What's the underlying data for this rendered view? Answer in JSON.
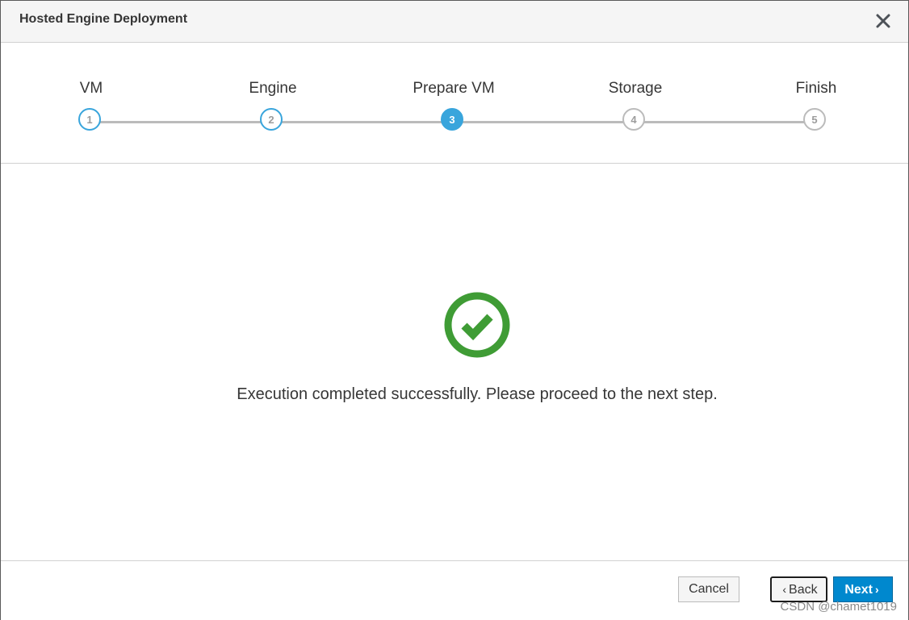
{
  "dialog": {
    "title": "Hosted Engine Deployment",
    "close_icon": "close-x-icon"
  },
  "wizard": {
    "steps": [
      {
        "label": "VM",
        "number": "1",
        "state": "done"
      },
      {
        "label": "Engine",
        "number": "2",
        "state": "done"
      },
      {
        "label": "Prepare VM",
        "number": "3",
        "state": "active"
      },
      {
        "label": "Storage",
        "number": "4",
        "state": "future"
      },
      {
        "label": "Finish",
        "number": "5",
        "state": "future"
      }
    ],
    "accent_color": "#39a5dc"
  },
  "content": {
    "status_icon": "check-circle-icon",
    "status_color": "#3f9c35",
    "message": "Execution completed successfully. Please proceed to the next step."
  },
  "footer": {
    "cancel_label": "Cancel",
    "back_label": "Back",
    "next_label": "Next",
    "back_icon": "chevron-left-icon",
    "next_icon": "chevron-right-icon",
    "primary_color": "#0088ce"
  },
  "watermark": "CSDN @chamet1019"
}
